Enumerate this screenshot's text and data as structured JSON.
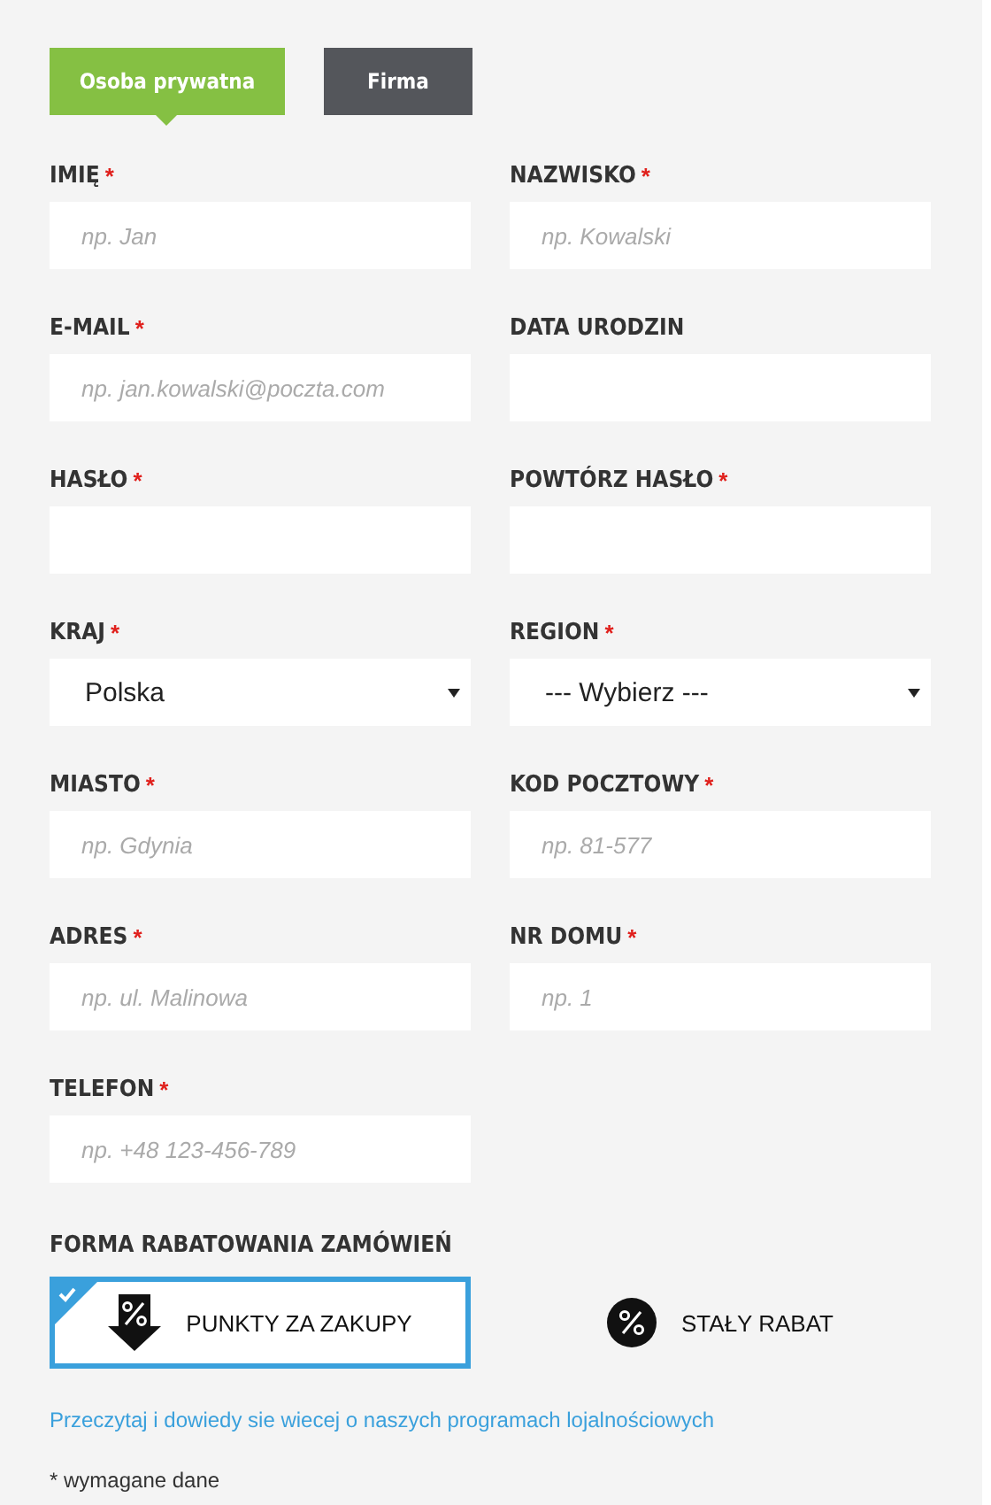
{
  "tabs": [
    {
      "label": "Osoba prywatna",
      "selected": true
    },
    {
      "label": "Firma",
      "selected": false
    }
  ],
  "fields": [
    {
      "label": "IMIĘ",
      "required_mark": "*",
      "kind": "text",
      "placeholder": "np. Jan"
    },
    {
      "label": "NAZWISKO",
      "required_mark": "*",
      "kind": "text",
      "placeholder": "np. Kowalski"
    },
    {
      "label": "E-MAIL",
      "required_mark": "*",
      "kind": "text",
      "placeholder": "np. jan.kowalski@poczta.com"
    },
    {
      "label": "DATA URODZIN",
      "kind": "text"
    },
    {
      "label": "HASŁO",
      "required_mark": "*",
      "kind": "text"
    },
    {
      "label": "POWTÓRZ HASŁO",
      "required_mark": "*",
      "kind": "text"
    },
    {
      "label": "KRAJ",
      "required_mark": "*",
      "kind": "select",
      "value": "Polska"
    },
    {
      "label": "REGION",
      "required_mark": "*",
      "kind": "select",
      "value": "--- Wybierz ---"
    },
    {
      "label": "MIASTO",
      "required_mark": "*",
      "kind": "text",
      "placeholder": "np. Gdynia"
    },
    {
      "label": "KOD POCZTOWY",
      "required_mark": "*",
      "kind": "text",
      "placeholder": "np. 81-577"
    },
    {
      "label": "ADRES",
      "required_mark": "*",
      "kind": "text",
      "placeholder": "np. ul. Malinowa"
    },
    {
      "label": "NR DOMU",
      "required_mark": "*",
      "kind": "text",
      "placeholder": "np. 1"
    },
    {
      "label": "TELEFON",
      "required_mark": "*",
      "kind": "text",
      "placeholder": "np. +48 123-456-789"
    }
  ],
  "discount": {
    "label": "FORMA RABATOWANIA ZAMÓWIEŃ",
    "options": [
      {
        "label": "PUNKTY ZA ZAKUPY",
        "kind": "arrow",
        "selected": true
      },
      {
        "label": "STAŁY RABAT",
        "kind": "circle",
        "selected": false
      }
    ]
  },
  "link": "Przeczytaj i dowiedy sie wiecej o naszych programach lojalnościowych",
  "footnote": "* wymagane dane"
}
